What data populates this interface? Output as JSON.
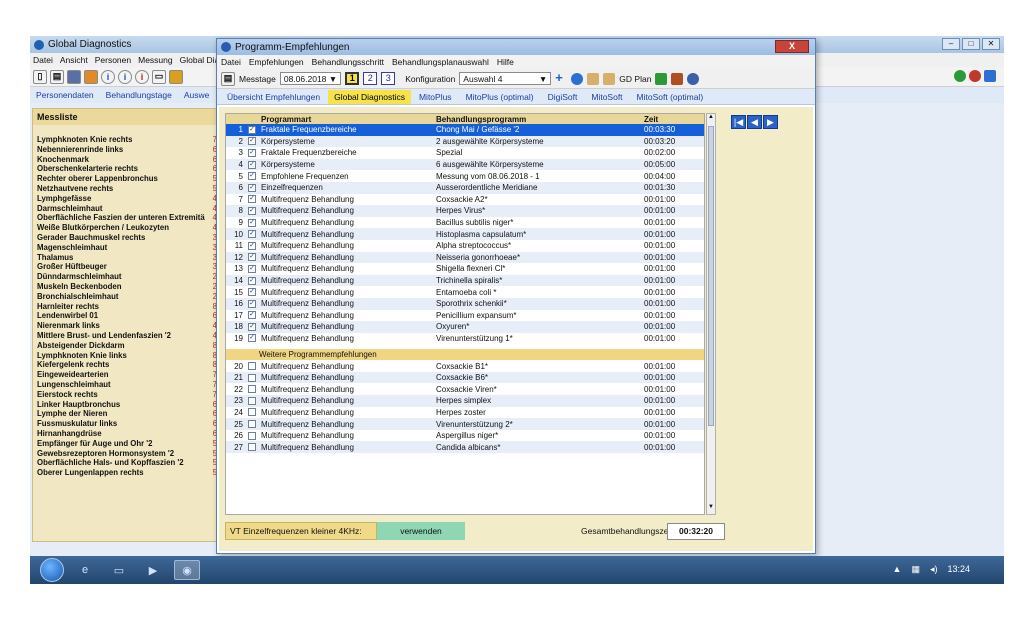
{
  "back_window": {
    "title": "Global Diagnostics",
    "menu": [
      "Datei",
      "Ansicht",
      "Personen",
      "Messung",
      "Global Dia"
    ],
    "tabs": [
      "Personendaten",
      "Behandlungstage",
      "Auswe"
    ],
    "panel_title": "Messliste",
    "items": [
      {
        "name": "Lymphknoten Knie rechts",
        "v": "7"
      },
      {
        "name": "Nebennierenrinde links",
        "v": "6"
      },
      {
        "name": "Knochenmark",
        "v": "6"
      },
      {
        "name": "Oberschenkelarterie rechts",
        "v": "6"
      },
      {
        "name": "Rechter oberer Lappenbronchus",
        "v": "5"
      },
      {
        "name": "Netzhautvene rechts",
        "v": "5"
      },
      {
        "name": "Lymphgefässe",
        "v": "4"
      },
      {
        "name": "Darmschleimhaut",
        "v": "4"
      },
      {
        "name": "Oberflächliche Faszien der unteren Extremitä",
        "v": "4"
      },
      {
        "name": "Weiße Blutkörperchen / Leukozyten",
        "v": "4"
      },
      {
        "name": "Gerader Bauchmuskel rechts",
        "v": "3"
      },
      {
        "name": "Magenschleimhaut",
        "v": "3"
      },
      {
        "name": "Thalamus",
        "v": "3"
      },
      {
        "name": "Großer Hüftbeuger",
        "v": "3"
      },
      {
        "name": "Dünndarmschleimhaut",
        "v": "2"
      },
      {
        "name": "Muskeln Beckenboden",
        "v": "2"
      },
      {
        "name": "Bronchialschleimhaut",
        "v": "2"
      },
      {
        "name": "Harnleiter rechts",
        "v": "8"
      },
      {
        "name": "Lendenwirbel 01",
        "v": "6"
      },
      {
        "name": "Nierenmark links",
        "v": "4"
      },
      {
        "name": "Mittlere Brust- und Lendenfaszien '2",
        "v": "4"
      },
      {
        "name": "Absteigender Dickdarm",
        "v": "8"
      },
      {
        "name": "Lymphknoten Knie links",
        "v": "8"
      },
      {
        "name": "Kiefergelenk rechts",
        "v": "8"
      },
      {
        "name": "Eingeweidearterien",
        "v": "7"
      },
      {
        "name": "Lungenschleimhaut",
        "v": "7"
      },
      {
        "name": "Eierstock rechts",
        "v": "7"
      },
      {
        "name": "Linker Hauptbronchus",
        "v": "6"
      },
      {
        "name": "Lymphe der Nieren",
        "v": "6"
      },
      {
        "name": "Fussmuskulatur links",
        "v": "6"
      },
      {
        "name": "Hirnanhangdrüse",
        "v": "6"
      },
      {
        "name": "Empfänger für Auge und Ohr '2",
        "v": "5"
      },
      {
        "name": "Gewebsrezeptoren Hormonsystem '2",
        "v": "5"
      },
      {
        "name": "Oberflächliche Hals- und Kopffaszien '2",
        "v": "5"
      },
      {
        "name": "Oberer Lungenlappen rechts",
        "v": "5"
      }
    ]
  },
  "dialog": {
    "title": "Programm-Empfehlungen",
    "close": "X",
    "menu": [
      "Datei",
      "Empfehlungen",
      "Behandlungsschritt",
      "Behandlungsplanauswahl",
      "Hilfe"
    ],
    "toolbar": {
      "messtage_label": "Messtage",
      "messtage_value": "08.06.2018",
      "nums": [
        "1",
        "2",
        "3"
      ],
      "konfig_label": "Konfiguration",
      "konfig_value": "Auswahl 4",
      "gd_plan": "GD Plan"
    },
    "tabs": [
      "Übersicht Empfehlungen",
      "Global Diagnostics",
      "MitoPlus",
      "MitoPlus (optimal)",
      "DigiSoft",
      "MitoSoft",
      "MitoSoft (optimal)"
    ],
    "columns": [
      "Programmart",
      "Behandlungsprogramm",
      "Zeit"
    ],
    "rows": [
      {
        "no": "1",
        "art": "Fraktale Frequenzbereiche",
        "prog": "Chong Mai / Gefässe '2",
        "zeit": "00:03:30"
      },
      {
        "no": "2",
        "art": "Körpersysteme",
        "prog": "2 ausgewählte Körpersysteme",
        "zeit": "00:03:20"
      },
      {
        "no": "3",
        "art": "Fraktale Frequenzbereiche",
        "prog": "Spezial",
        "zeit": "00:02:00"
      },
      {
        "no": "4",
        "art": "Körpersysteme",
        "prog": "6 ausgewählte Körpersysteme",
        "zeit": "00:05:00"
      },
      {
        "no": "5",
        "art": "Empfohlene Frequenzen",
        "prog": "Messung vom 08.06.2018 - 1",
        "zeit": "00:04:00"
      },
      {
        "no": "6",
        "art": "Einzelfrequenzen",
        "prog": "Ausserordentliche Meridiane",
        "zeit": "00:01:30"
      },
      {
        "no": "7",
        "art": "Multifrequenz Behandlung",
        "prog": "Coxsackie A2*",
        "zeit": "00:01:00"
      },
      {
        "no": "8",
        "art": "Multifrequenz Behandlung",
        "prog": "Herpes Virus*",
        "zeit": "00:01:00"
      },
      {
        "no": "9",
        "art": "Multifrequenz Behandlung",
        "prog": "Bacillus subtilis niger*",
        "zeit": "00:01:00"
      },
      {
        "no": "10",
        "art": "Multifrequenz Behandlung",
        "prog": "Histoplasma capsulatum*",
        "zeit": "00:01:00"
      },
      {
        "no": "11",
        "art": "Multifrequenz Behandlung",
        "prog": "Alpha streptococcus*",
        "zeit": "00:01:00"
      },
      {
        "no": "12",
        "art": "Multifrequenz Behandlung",
        "prog": "Neisseria gonorrhoeae*",
        "zeit": "00:01:00"
      },
      {
        "no": "13",
        "art": "Multifrequenz Behandlung",
        "prog": "Shigella flexneri Cl*",
        "zeit": "00:01:00"
      },
      {
        "no": "14",
        "art": "Multifrequenz Behandlung",
        "prog": "Trichinella spiralis*",
        "zeit": "00:01:00"
      },
      {
        "no": "15",
        "art": "Multifrequenz Behandlung",
        "prog": "Entamoeba coli *",
        "zeit": "00:01:00"
      },
      {
        "no": "16",
        "art": "Multifrequenz Behandlung",
        "prog": "Sporothrix schenkii*",
        "zeit": "00:01:00"
      },
      {
        "no": "17",
        "art": "Multifrequenz Behandlung",
        "prog": "Penicillium expansum*",
        "zeit": "00:01:00"
      },
      {
        "no": "18",
        "art": "Multifrequenz Behandlung",
        "prog": "Oxyuren*",
        "zeit": "00:01:00"
      },
      {
        "no": "19",
        "art": "Multifrequenz Behandlung",
        "prog": "Virenunterstützung 1*",
        "zeit": "00:01:00"
      }
    ],
    "section_label": "Weitere Programmempfehlungen",
    "rows2": [
      {
        "no": "20",
        "art": "Multifrequenz Behandlung",
        "prog": "Coxsackie B1*",
        "zeit": "00:01:00"
      },
      {
        "no": "21",
        "art": "Multifrequenz Behandlung",
        "prog": "Coxsackie B6*",
        "zeit": "00:01:00"
      },
      {
        "no": "22",
        "art": "Multifrequenz Behandlung",
        "prog": "Coxsackie Viren*",
        "zeit": "00:01:00"
      },
      {
        "no": "23",
        "art": "Multifrequenz Behandlung",
        "prog": "Herpes simplex",
        "zeit": "00:01:00"
      },
      {
        "no": "24",
        "art": "Multifrequenz Behandlung",
        "prog": "Herpes zoster",
        "zeit": "00:01:00"
      },
      {
        "no": "25",
        "art": "Multifrequenz Behandlung",
        "prog": "Virenunterstützung 2*",
        "zeit": "00:01:00"
      },
      {
        "no": "26",
        "art": "Multifrequenz Behandlung",
        "prog": "Aspergillus niger*",
        "zeit": "00:01:00"
      },
      {
        "no": "27",
        "art": "Multifrequenz Behandlung",
        "prog": "Candida albicans*",
        "zeit": "00:01:00"
      }
    ],
    "footer": {
      "vt_label": "VT Einzelfrequenzen kleiner 4KHz:",
      "vt_button": "verwenden",
      "gesamt_label": "Gesamtbehandlungszeit",
      "gesamt_value": "00:32:20"
    }
  },
  "taskbar": {
    "clock": "13:24"
  },
  "colors": {
    "selection": "#1560d8",
    "accent_tab": "#f6e24a"
  }
}
